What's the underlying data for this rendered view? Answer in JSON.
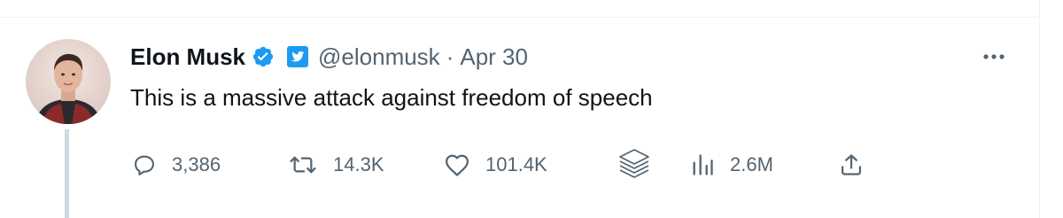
{
  "tweet": {
    "author_name": "Elon Musk",
    "handle": "@elonmusk",
    "separator": "·",
    "date": "Apr 30",
    "text": "This is a massive attack against freedom of speech"
  },
  "stats": {
    "replies": "3,386",
    "retweets": "14.3K",
    "likes": "101.4K",
    "views": "2.6M"
  },
  "colors": {
    "verified_blue": "#1d9bf0",
    "muted_text": "#536471",
    "primary_text": "#0f1419"
  },
  "icons": [
    "verified-badge-icon",
    "twitter-bird-affiliate-icon",
    "more-icon",
    "reply-icon",
    "retweet-icon",
    "like-icon",
    "stack-icon",
    "views-icon",
    "share-icon"
  ]
}
